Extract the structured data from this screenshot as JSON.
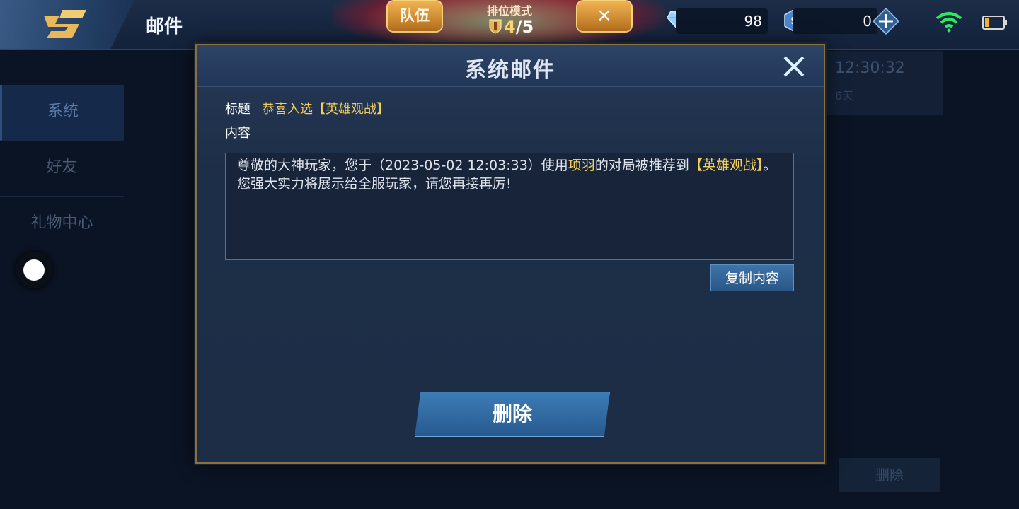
{
  "header": {
    "title": "邮件",
    "team_tab": "队伍",
    "rank_mode": "排位模式",
    "rank_current": "4",
    "rank_total": "/5",
    "close_tab": "×",
    "diamond_value": "98",
    "voucher_value": "0"
  },
  "sidebar": {
    "items": [
      {
        "label": "系统"
      },
      {
        "label": "好友"
      },
      {
        "label": "礼物中心"
      }
    ]
  },
  "background_mail": {
    "time": "12:30:32",
    "days": "6天",
    "delete_label": "删除"
  },
  "modal": {
    "title": "系统邮件",
    "subject_label": "标题",
    "subject_value": "恭喜入选【英雄观战】",
    "content_label": "内容",
    "content": {
      "part1": "尊敬的大神玩家，您于（2023-05-02 12:03:33）使用",
      "hero": "项羽",
      "part2": "的对局被推荐到",
      "highlight": "【英雄观战】",
      "part3": "。",
      "line2": "您强大实力将展示给全服玩家，请您再接再厉!"
    },
    "copy_label": "复制内容",
    "delete_label": "删除"
  },
  "colors": {
    "accent_gold": "#f2cf5c",
    "button_blue": "#3d7cb6",
    "wifi_green": "#2ee860"
  }
}
